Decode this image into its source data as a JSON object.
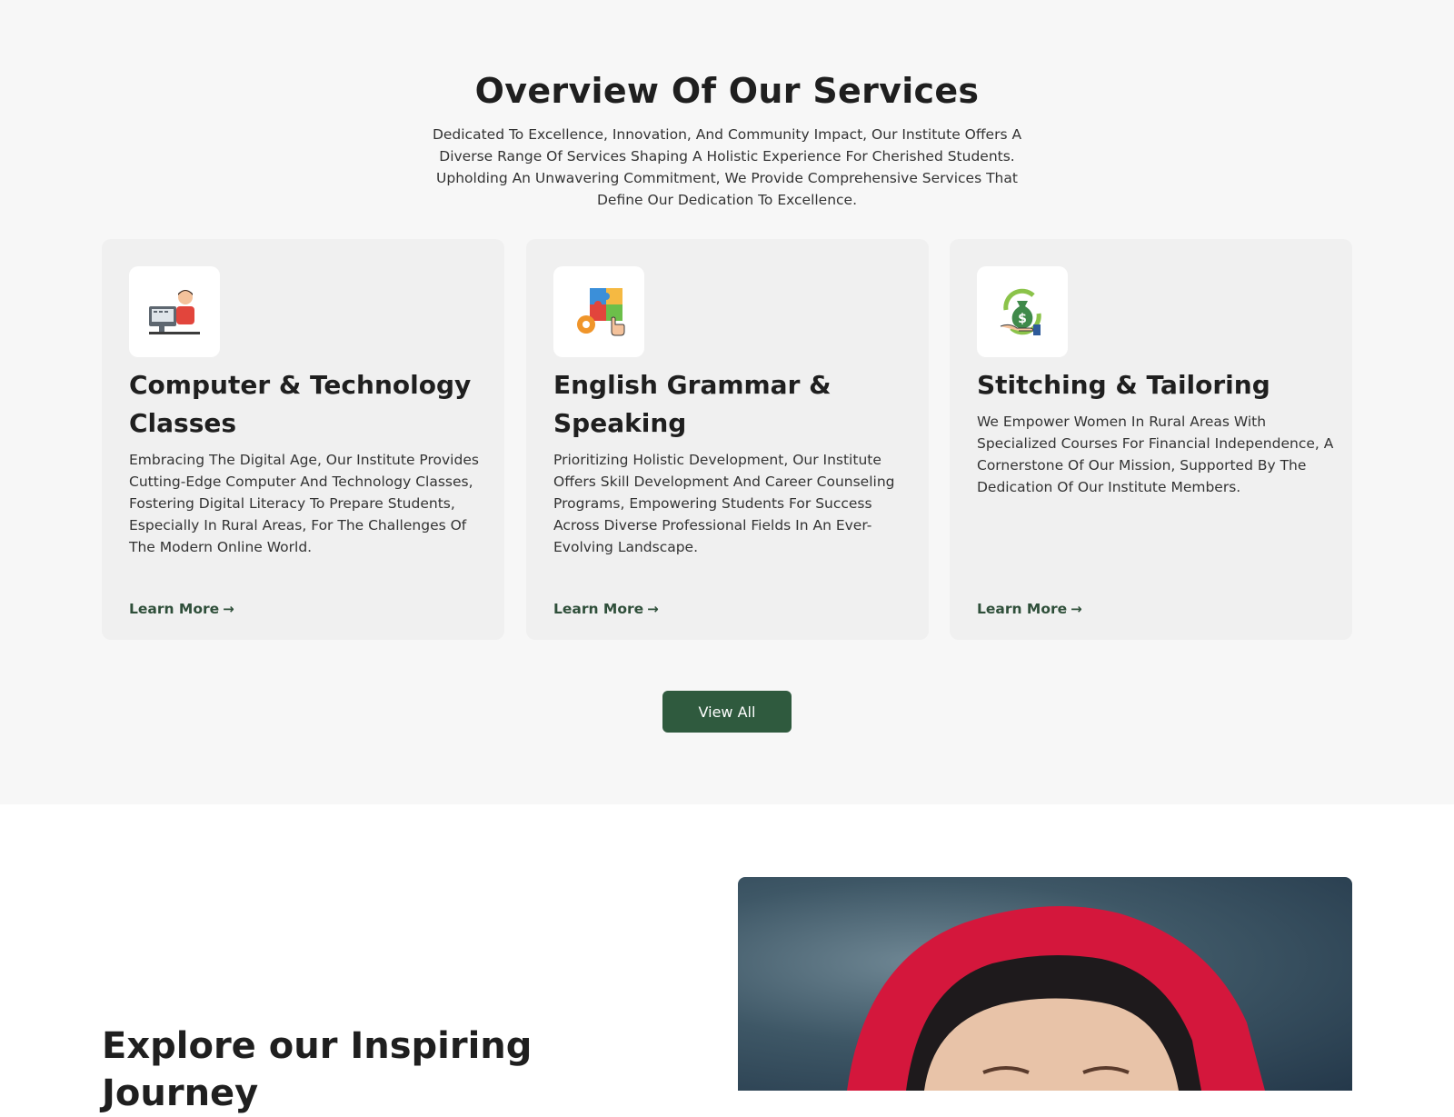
{
  "services": {
    "title": "Overview Of Our Services",
    "subtitle": "Dedicated To Excellence, Innovation, And Community Impact, Our Institute Offers A Diverse Range Of Services Shaping A Holistic Experience For Cherished Students. Upholding An Unwavering Commitment, We Provide Comprehensive Services That Define Our Dedication To Excellence.",
    "cards": [
      {
        "icon": "computer-classes-icon",
        "title": "Computer & Technology Classes",
        "text": "Embracing The Digital Age, Our Institute Provides Cutting-Edge Computer And Technology Classes, Fostering Digital Literacy To Prepare Students, Especially In Rural Areas, For The Challenges Of The Modern Online World.",
        "link": "Learn More"
      },
      {
        "icon": "puzzle-skills-icon",
        "title": "English Grammar & Speaking",
        "text": "Prioritizing Holistic Development, Our Institute Offers Skill Development And Career Counseling Programs, Empowering Students For Success Across Diverse Professional Fields In An Ever-Evolving Landscape.",
        "link": "Learn More"
      },
      {
        "icon": "money-bag-icon",
        "title": "Stitching & Tailoring",
        "text": "We Empower Women In Rural Areas With Specialized Courses For Financial Independence, A Cornerstone Of Our Mission, Supported By The Dedication Of Our Institute Members.",
        "link": "Learn More"
      }
    ],
    "view_all": "View All"
  },
  "journey": {
    "title": "Explore our Inspiring Journey"
  },
  "colors": {
    "accent": "#2f5a3e",
    "link": "#2f4f3a",
    "section_bg": "#f7f7f7",
    "card_bg": "#f0f0f0"
  }
}
